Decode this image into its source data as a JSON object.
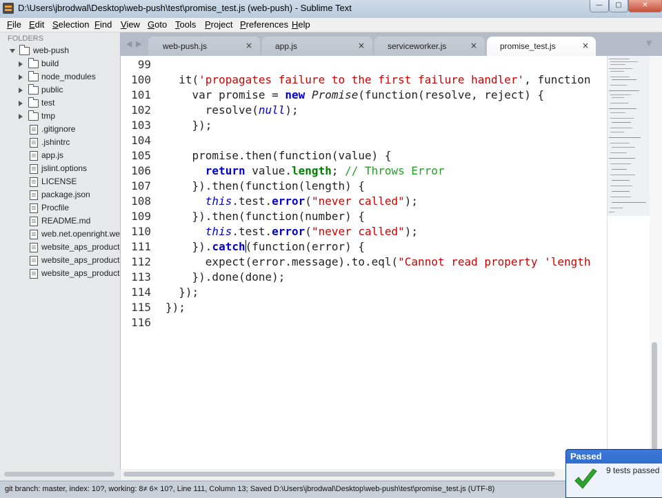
{
  "window": {
    "title": "D:\\Users\\jbrodwal\\Desktop\\web-push\\test\\promise_test.js (web-push) - Sublime Text",
    "minimize": "—",
    "maximize": "▢",
    "close": "✕"
  },
  "menu": [
    "File",
    "Edit",
    "Selection",
    "Find",
    "View",
    "Goto",
    "Tools",
    "Project",
    "Preferences",
    "Help"
  ],
  "sidebar": {
    "header": "FOLDERS",
    "root": "web-push",
    "folders": [
      "build",
      "node_modules",
      "public",
      "test",
      "tmp"
    ],
    "files": [
      ".gitignore",
      ".jshintrc",
      "app.js",
      "jslint.options",
      "LICENSE",
      "package.json",
      "Procfile",
      "README.md",
      "web.net.openright.we",
      "website_aps_productio",
      "website_aps_productio",
      "website_aps_productio"
    ]
  },
  "tabs": [
    {
      "label": "web-push.js",
      "close": "×",
      "active": false
    },
    {
      "label": "app.js",
      "close": "×",
      "active": false
    },
    {
      "label": "serviceworker.js",
      "close": "×",
      "active": false
    },
    {
      "label": "promise_test.js",
      "close": "×",
      "active": true
    }
  ],
  "editor": {
    "line_numbers": [
      "99",
      "100",
      "101",
      "102",
      "103",
      "104",
      "105",
      "106",
      "107",
      "108",
      "109",
      "110",
      "111",
      "112",
      "113",
      "114",
      "115",
      "116"
    ],
    "current_line": "111"
  },
  "status": {
    "text": "git branch: master, index: 10?, working: 8≠ 6× 10?, Line 111, Column 13; Saved D:\\Users\\jbrodwal\\Desktop\\web-push\\test\\promise_test.js (UTF-8)"
  },
  "toast": {
    "title": "Passed",
    "message": "9 tests passed"
  },
  "colors": {
    "keyword": "#0000cc",
    "string": "#cc0000",
    "comment": "#22a022",
    "toast": "#2a67cc",
    "check": "#2fa32f"
  }
}
